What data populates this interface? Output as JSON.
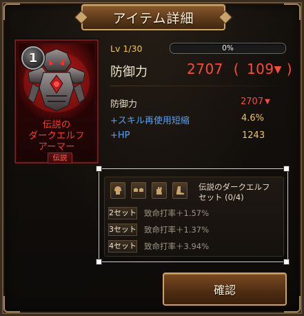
{
  "window": {
    "title": "アイテム詳細"
  },
  "item": {
    "level_badge": "1",
    "name_lines": [
      "伝説の",
      "ダークエルフ",
      "アーマー"
    ],
    "rarity": "伝説",
    "level_label": "Lv 1/30",
    "exp_percent_text": "0%",
    "exp_progress": 0
  },
  "main_stat": {
    "label": "防御力",
    "value": "2707",
    "delta_open": "(",
    "delta": "109",
    "delta_arrow": "▼",
    "delta_close": ")"
  },
  "sub_stats": [
    {
      "label": "防御力",
      "value": "2707",
      "arrow": "▼"
    },
    {
      "label": "+スキル再使用短縮",
      "value": "4.6%"
    },
    {
      "label": "+HP",
      "value": "1243"
    }
  ],
  "set": {
    "name": "伝説のダークエルフセット (0/4)",
    "name_line1": "伝説のダークエルフ",
    "name_line2": "セット (0/4)",
    "piece_icons": [
      "helmet-icon",
      "shoulder-icon",
      "glove-icon",
      "boots-icon"
    ],
    "bonuses": [
      {
        "tag": "2セット",
        "text": "致命打率＋1.57%"
      },
      {
        "tag": "3セット",
        "text": "致命打率＋1.37%"
      },
      {
        "tag": "4セット",
        "text": "致命打率＋3.94%"
      }
    ]
  },
  "buttons": {
    "confirm": "確認"
  },
  "colors": {
    "red_value": "#ff4a3a",
    "gold_value": "#f0c650",
    "blue_label": "#5aa0f0",
    "legend_red": "#ff3b2b"
  }
}
